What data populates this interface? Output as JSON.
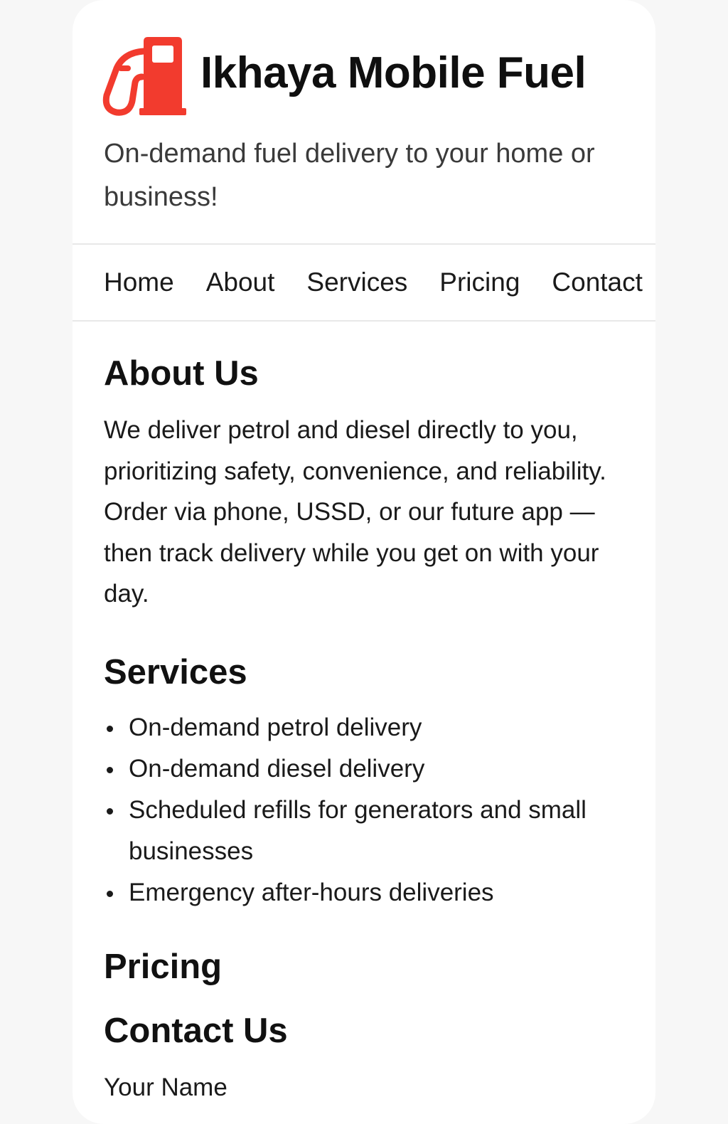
{
  "header": {
    "title": "Ikhaya Mobile Fuel",
    "tagline": "On-demand fuel delivery to your home or business!",
    "logo_icon": "fuel-pump-icon",
    "brand_color": "#f23b2e"
  },
  "nav": {
    "items": [
      {
        "label": "Home"
      },
      {
        "label": "About"
      },
      {
        "label": "Services"
      },
      {
        "label": "Pricing"
      },
      {
        "label": "Contact"
      }
    ]
  },
  "about": {
    "title": "About Us",
    "text": "We deliver petrol and diesel directly to you, prioritizing safety, convenience, and reliability. Order via phone, USSD, or our future app — then track delivery while you get on with your day."
  },
  "services": {
    "title": "Services",
    "items": [
      "On-demand petrol delivery",
      "On-demand diesel delivery",
      "Scheduled refills for generators and small businesses",
      "Emergency after-hours deliveries"
    ]
  },
  "pricing": {
    "title": "Pricing"
  },
  "contact": {
    "title": "Contact Us",
    "name_label": "Your Name"
  }
}
